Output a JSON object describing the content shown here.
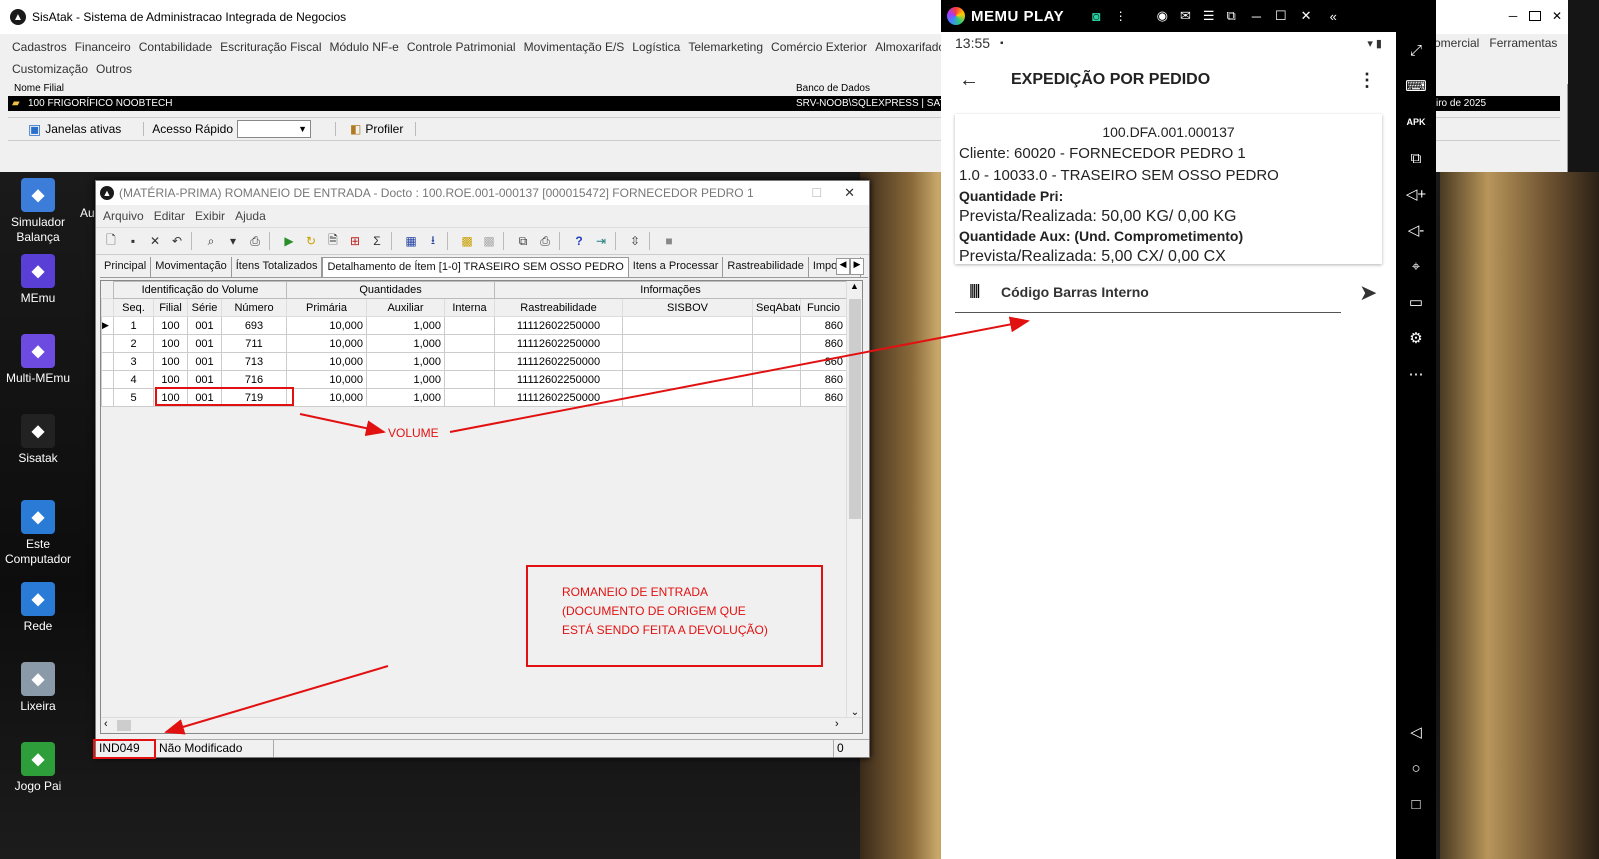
{
  "main_window": {
    "title": "SisAtak - Sistema de Administracao Integrada de Negocios",
    "menu": [
      "Cadastros",
      "Financeiro",
      "Contabilidade",
      "Escrituração Fiscal",
      "Módulo NF-e",
      "Controle Patrimonial",
      "Movimentação E/S",
      "Logística",
      "Telemarketing",
      "Comércio Exterior",
      "Almoxarifado"
    ],
    "menu_row2": [
      "Customização",
      "Outros"
    ],
    "menu_right": [
      "omercial",
      "Ferramentas"
    ],
    "filial_header": "Nome Filial",
    "db_header": "Banco de Dados",
    "filial_value": "100 FRIGORÍFICO NOOBTECH",
    "db_value": "SRV-NOOB\\SQLEXPRESS | SAT",
    "date_fragment": "iro de 2025",
    "toolbar": {
      "janelas": "Janelas ativas",
      "acesso": "Acesso Rápido",
      "profiler": "Profiler"
    }
  },
  "desktop_icons": [
    {
      "label": "Simulador Balança",
      "icon": "scale-icon",
      "color": "#3b7dd8"
    },
    {
      "label": "MEmu",
      "icon": "memu-icon",
      "color": "#5a3fd6"
    },
    {
      "label": "Multi-MEmu",
      "icon": "multi-memu-icon",
      "color": "#6d4be0"
    },
    {
      "label": "Sisatak",
      "icon": "sisatak-icon",
      "color": "#222222"
    },
    {
      "label": "Este Computador",
      "icon": "computer-icon",
      "color": "#2a7bd6"
    },
    {
      "label": "Rede",
      "icon": "network-icon",
      "color": "#2a7bd6"
    },
    {
      "label": "Lixeira",
      "icon": "recycle-bin-icon",
      "color": "#8a9aa8"
    },
    {
      "label": "Jogo Pai",
      "icon": "game-icon",
      "color": "#2e9e3a"
    }
  ],
  "desktop_partial_label": "Au",
  "romaneio": {
    "title": "(MATÉRIA-PRIMA) ROMANEIO DE ENTRADA - Docto : 100.ROE.001-000137 [000015472] FORNECEDOR PEDRO 1",
    "menu": [
      "Arquivo",
      "Editar",
      "Exibir",
      "Ajuda"
    ],
    "tabs": [
      "Principal",
      "Movimentação",
      "Ítens Totalizados",
      "Detalhamento de Ítem [1-0] TRASEIRO SEM OSSO PEDRO",
      "Itens a Processar",
      "Rastreabilidade",
      "Importaç"
    ],
    "active_tab": 3,
    "group_headers": [
      "Identificação do Volume",
      "Quantidades",
      "Informações"
    ],
    "columns": [
      "Seq.",
      "Filial",
      "Série",
      "Número",
      "Primária",
      "Auxiliar",
      "Interna",
      "Rastreabilidade",
      "SISBOV",
      "SeqAbate",
      "Funcio"
    ],
    "rows": [
      [
        "1",
        "100",
        "001",
        "693",
        "10,000",
        "1,000",
        "",
        "11112602250000",
        "",
        "",
        "860"
      ],
      [
        "2",
        "100",
        "001",
        "711",
        "10,000",
        "1,000",
        "",
        "11112602250000",
        "",
        "",
        "860"
      ],
      [
        "3",
        "100",
        "001",
        "713",
        "10,000",
        "1,000",
        "",
        "11112602250000",
        "",
        "",
        "860"
      ],
      [
        "4",
        "100",
        "001",
        "716",
        "10,000",
        "1,000",
        "",
        "11112602250000",
        "",
        "",
        "860"
      ],
      [
        "5",
        "100",
        "001",
        "719",
        "10,000",
        "1,000",
        "",
        "11112602250000",
        "",
        "",
        "860"
      ]
    ],
    "status": {
      "code": "IND049",
      "state": "Não Modificado",
      "count": "0"
    }
  },
  "memu": {
    "brand": "MEMU PLAY",
    "time": "13:55",
    "app_title": "EXPEDIÇÃO POR PEDIDO",
    "doc": "100.DFA.001.000137",
    "cliente": "Cliente: 60020 - FORNECEDOR PEDRO 1",
    "item": "1.0 - 10033.0 - TRASEIRO SEM OSSO PEDRO",
    "qtd_pri_label": "Quantidade Pri:",
    "qtd_pri_value": "Prevista/Realizada:  50,00 KG/ 0,00 KG",
    "qtd_aux_label": "Quantidade Aux: (Und. Comprometimento)",
    "qtd_aux_value": "Prevista/Realizada:  5,00 CX/ 0,00 CX",
    "barcode_placeholder": "Código Barras Interno",
    "accent": "#000000"
  },
  "annotations": {
    "volume": "VOLUME",
    "romaneio_note": "ROMANEIO DE ENTRADA\n(DOCUMENTO DE ORIGEM QUE\nESTÁ SENDO FEITA A DEVOLUÇÃO)",
    "color": "#e21111"
  }
}
